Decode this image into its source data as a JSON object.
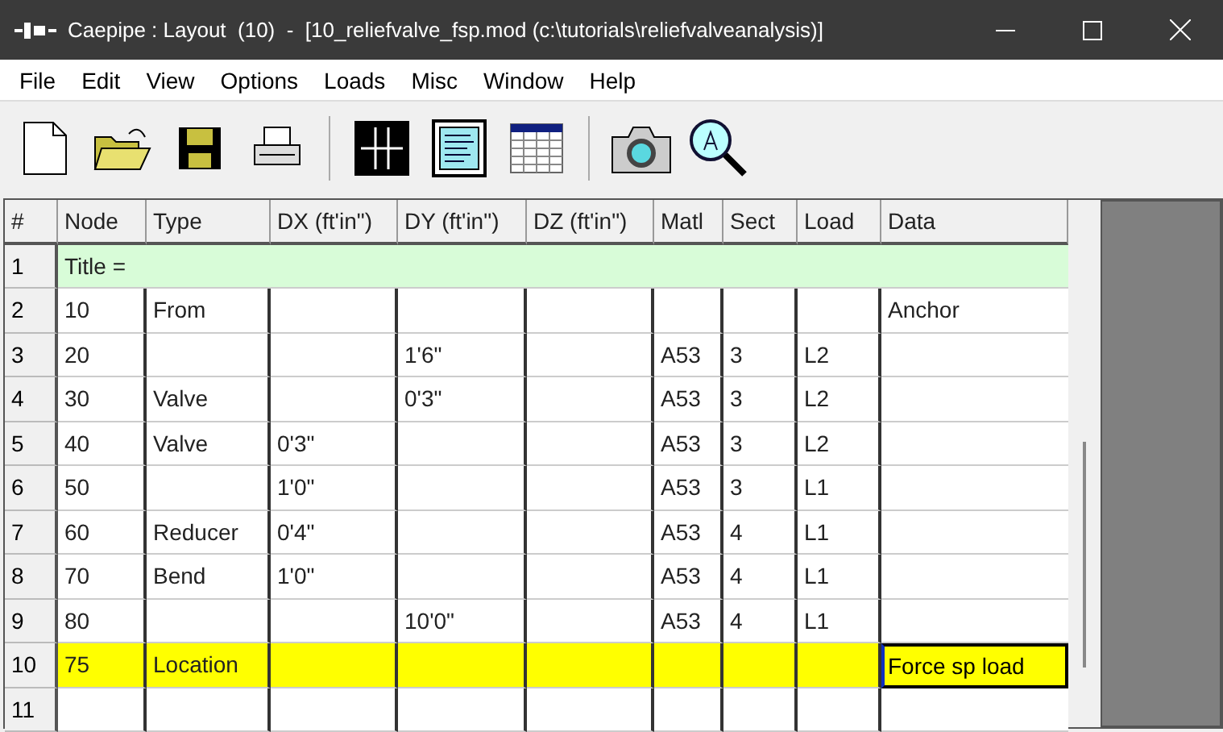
{
  "window": {
    "title": "Caepipe : Layout  (10)  -  [10_reliefvalve_fsp.mod (c:\\tutorials\\reliefvalveanalysis)]"
  },
  "menu": [
    "File",
    "Edit",
    "View",
    "Options",
    "Loads",
    "Misc",
    "Window",
    "Help"
  ],
  "toolbar": [
    {
      "kind": "new"
    },
    {
      "kind": "open"
    },
    {
      "kind": "save"
    },
    {
      "kind": "print"
    },
    {
      "kind": "separator"
    },
    {
      "kind": "graphics"
    },
    {
      "kind": "list"
    },
    {
      "kind": "table"
    },
    {
      "kind": "separator"
    },
    {
      "kind": "camera"
    },
    {
      "kind": "zoom"
    }
  ],
  "table": {
    "columns": [
      "#",
      "Node",
      "Type",
      "DX (ft'in\")",
      "DY (ft'in\")",
      "DZ (ft'in\")",
      "Matl",
      "Sect",
      "Load",
      "Data"
    ],
    "rows": [
      {
        "kind": "title",
        "selected": false,
        "cells": [
          "1",
          "Title ="
        ]
      },
      {
        "kind": "data",
        "selected": false,
        "cells": [
          "2",
          "10",
          "From",
          "",
          "",
          "",
          "",
          "",
          "",
          "Anchor"
        ]
      },
      {
        "kind": "data",
        "selected": false,
        "cells": [
          "3",
          "20",
          "",
          "",
          "1'6\"",
          "",
          "A53",
          "3",
          "L2",
          ""
        ]
      },
      {
        "kind": "data",
        "selected": false,
        "cells": [
          "4",
          "30",
          "Valve",
          "",
          "0'3\"",
          "",
          "A53",
          "3",
          "L2",
          ""
        ]
      },
      {
        "kind": "data",
        "selected": false,
        "cells": [
          "5",
          "40",
          "Valve",
          "0'3\"",
          "",
          "",
          "A53",
          "3",
          "L2",
          ""
        ]
      },
      {
        "kind": "data",
        "selected": false,
        "cells": [
          "6",
          "50",
          "",
          "1'0\"",
          "",
          "",
          "A53",
          "3",
          "L1",
          ""
        ]
      },
      {
        "kind": "data",
        "selected": false,
        "cells": [
          "7",
          "60",
          "Reducer",
          "0'4\"",
          "",
          "",
          "A53",
          "4",
          "L1",
          ""
        ]
      },
      {
        "kind": "data",
        "selected": false,
        "cells": [
          "8",
          "70",
          "Bend",
          "1'0\"",
          "",
          "",
          "A53",
          "4",
          "L1",
          ""
        ]
      },
      {
        "kind": "data",
        "selected": false,
        "cells": [
          "9",
          "80",
          "",
          "",
          "10'0\"",
          "",
          "A53",
          "4",
          "L1",
          ""
        ]
      },
      {
        "kind": "data",
        "selected": true,
        "cells": [
          "10",
          "75",
          "Location",
          "",
          "",
          "",
          "",
          "",
          "",
          "Force sp load"
        ]
      },
      {
        "kind": "data",
        "selected": false,
        "cells": [
          "11",
          "",
          "",
          "",
          "",
          "",
          "",
          "",
          "",
          ""
        ]
      }
    ]
  }
}
